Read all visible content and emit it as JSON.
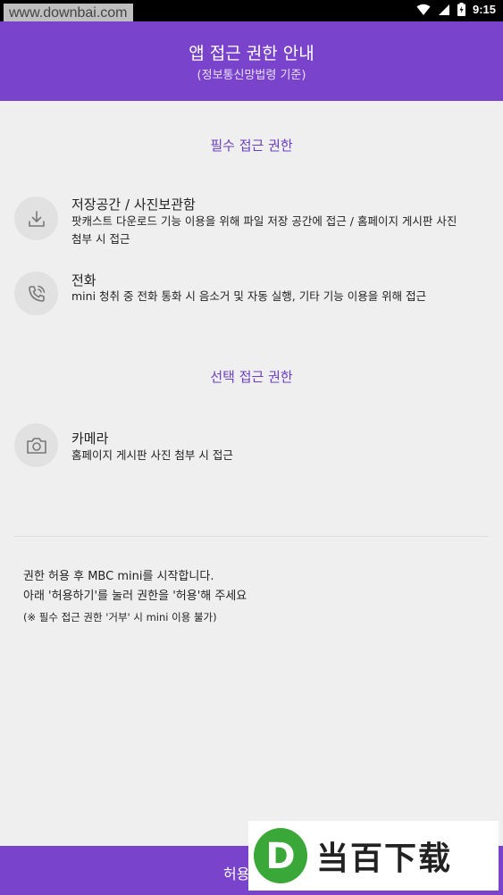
{
  "status_bar": {
    "watermark": "www.downbai.com",
    "time": "9:15"
  },
  "header": {
    "title": "앱 접근 권한 안내",
    "subtitle": "(정보통신망법령 기준)"
  },
  "required_section": {
    "title": "필수 접근 권한",
    "items": [
      {
        "icon": "download-icon",
        "name": "저장공간 / 사진보관함",
        "desc_line1": "팟캐스트 다운로드 기능 이용을 위해 파일 저장 공간에 접근 / 홈페이지 게시판 사진",
        "desc_line2": "첨부 시 접근"
      },
      {
        "icon": "phone-icon",
        "name": "전화",
        "desc_line1": "mini 청취 중 전화 통화 시 음소거 및 자동 실행, 기타 기능 이용을 위해 접근"
      }
    ]
  },
  "optional_section": {
    "title": "선택 접근 권한",
    "items": [
      {
        "icon": "camera-icon",
        "name": "카메라",
        "desc_line1": "홈페이지 게시판 사진 첨부 시 접근"
      }
    ]
  },
  "notice": {
    "line1": "권한 허용 후 MBC mini를 시작합니다.",
    "line2": "아래 '허용하기'를 눌러 권한을 '허용'해 주세요",
    "line3": "(※ 필수 접근 권한 '거부' 시 mini 이용 불가)"
  },
  "bottom_button": {
    "label": "허용"
  },
  "bottom_watermark": {
    "logo_letter": "D",
    "text": "当百下载"
  },
  "colors": {
    "primary": "#7a43cc",
    "section_title": "#6b3fc0",
    "icon_bg": "#e1e1e1",
    "page_bg": "#efefef"
  }
}
